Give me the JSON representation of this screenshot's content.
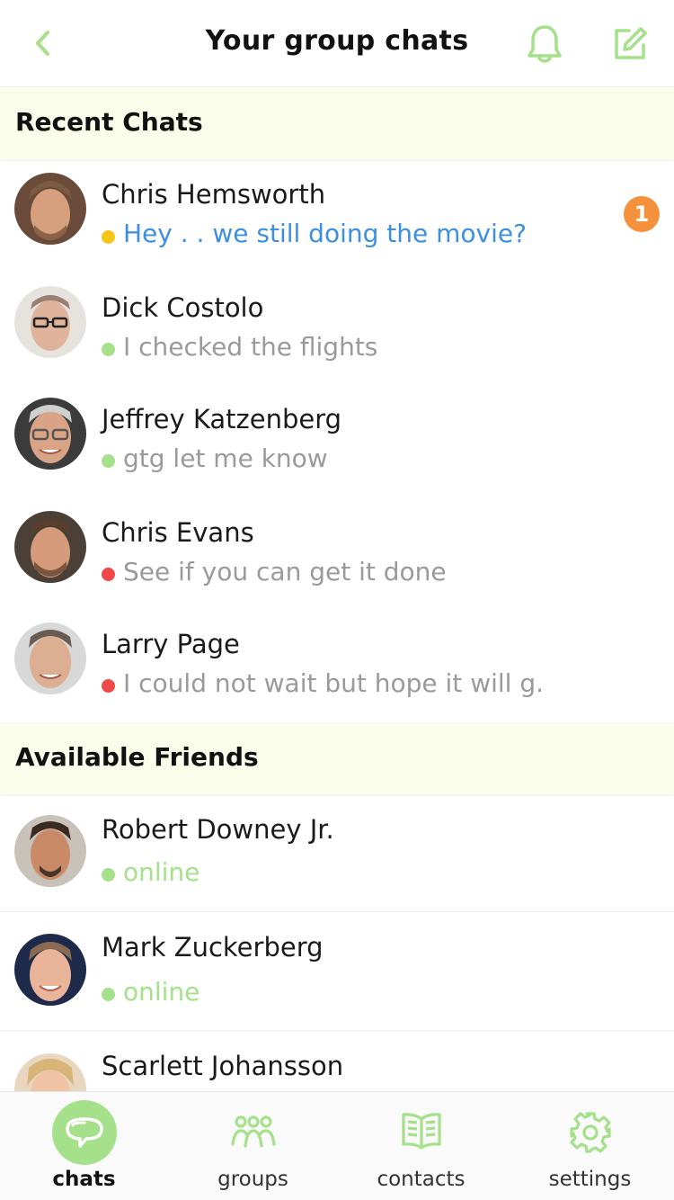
{
  "header": {
    "title": "Your group chats",
    "back_icon": "chevron-left-icon",
    "bell_icon": "bell-icon",
    "edit_icon": "compose-icon"
  },
  "colors": {
    "accent": "#a5e08a",
    "link": "#3d8fe0",
    "badge": "#f5913c",
    "section_bg": "#fafde9",
    "status_yellow": "#f5c518",
    "status_green": "#a5e08a",
    "status_red": "#ee4848"
  },
  "recent": {
    "title": "Recent Chats",
    "items": [
      {
        "name": "Chris Hemsworth",
        "message": "Hey . . we still doing the movie?",
        "status": "yellow",
        "unread": "1"
      },
      {
        "name": "Dick Costolo",
        "message": "I checked the flights",
        "status": "green"
      },
      {
        "name": "Jeffrey Katzenberg",
        "message": "gtg let me know",
        "status": "green"
      },
      {
        "name": "Chris Evans",
        "message": "See if you can get it done",
        "status": "red"
      },
      {
        "name": "Larry Page",
        "message": "I could not wait but hope it will g.",
        "status": "red"
      }
    ]
  },
  "friends": {
    "title": "Available Friends",
    "items": [
      {
        "name": "Robert Downey Jr.",
        "status_text": "online"
      },
      {
        "name": "Mark Zuckerberg",
        "status_text": "online"
      },
      {
        "name": "Scarlett Johansson",
        "status_text": ""
      }
    ]
  },
  "tabs": [
    {
      "label": "chats",
      "icon": "chat-bubble-icon",
      "active": true
    },
    {
      "label": "groups",
      "icon": "group-icon",
      "active": false
    },
    {
      "label": "contacts",
      "icon": "book-icon",
      "active": false
    },
    {
      "label": "settings",
      "icon": "gear-icon",
      "active": false
    }
  ]
}
